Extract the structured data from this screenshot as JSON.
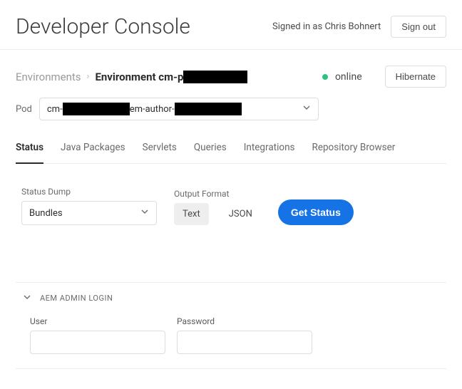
{
  "header": {
    "title": "Developer Console",
    "signed_in_prefix": "Signed in as ",
    "signed_in_user": "Chris Bohnert",
    "sign_out": "Sign out"
  },
  "breadcrumb": {
    "link": "Environments",
    "current_prefix": "Environment cm-p"
  },
  "env_status": {
    "label": "online",
    "hibernate": "Hibernate"
  },
  "pod": {
    "label": "Pod",
    "value_prefix": "cm-",
    "value_mid": "em-author-"
  },
  "tabs": [
    {
      "label": "Status",
      "active": true
    },
    {
      "label": "Java Packages",
      "active": false
    },
    {
      "label": "Servlets",
      "active": false
    },
    {
      "label": "Queries",
      "active": false
    },
    {
      "label": "Integrations",
      "active": false
    },
    {
      "label": "Repository Browser",
      "active": false
    }
  ],
  "status_dump": {
    "label": "Status Dump",
    "selected": "Bundles"
  },
  "output_format": {
    "label": "Output Format",
    "options": [
      {
        "label": "Text",
        "active": true
      },
      {
        "label": "JSON",
        "active": false
      }
    ]
  },
  "get_status": "Get Status",
  "login": {
    "title": "AEM ADMIN LOGIN",
    "user_label": "User",
    "password_label": "Password",
    "user_value": "",
    "password_value": ""
  }
}
